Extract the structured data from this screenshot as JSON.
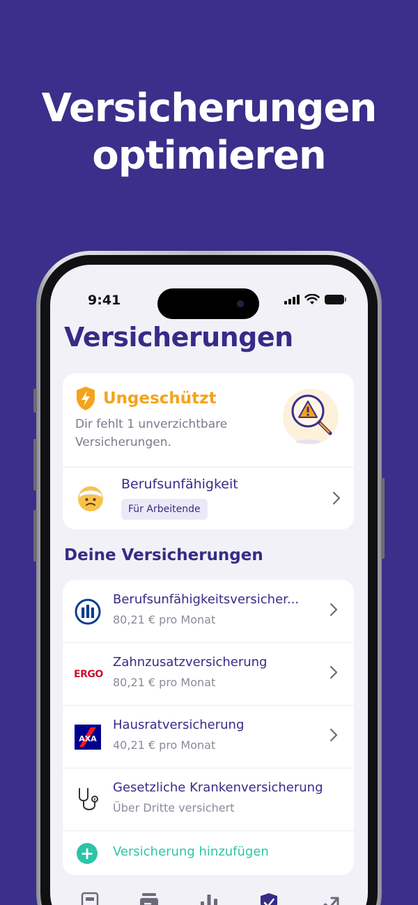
{
  "promo": {
    "headline_line1": "Versicherungen",
    "headline_line2": "optimieren"
  },
  "status_bar": {
    "time": "9:41"
  },
  "page": {
    "title": "Versicherungen"
  },
  "status_card": {
    "title": "Ungeschützt",
    "description": "Dir fehlt 1 unverzichtbare Versicherungen.",
    "missing_item": {
      "title": "Berufsunfähigkeit",
      "tag": "Für Arbeitende"
    }
  },
  "insurances": {
    "section_title": "Deine Versicherungen",
    "items": [
      {
        "title": "Berufsunfähigkeitsversicher...",
        "subtitle": "80,21 € pro Monat",
        "logo": "allianz-logo"
      },
      {
        "title": "Zahnzusatzversicherung",
        "subtitle": "80,21 € pro Monat",
        "logo": "ergo-logo",
        "logo_text": "ERGO"
      },
      {
        "title": "Hausratversicherung",
        "subtitle": "40,21 € pro Monat",
        "logo": "axa-logo",
        "logo_text": "AXA"
      },
      {
        "title": "Gesetzliche Krankenversicherung",
        "subtitle": "Über Dritte versichert",
        "logo": "stethoscope-icon"
      }
    ],
    "add_label": "Versicherung hinzufügen"
  },
  "colors": {
    "background": "#3a2f8a",
    "primary": "#352c86",
    "warning": "#f5a319",
    "accent": "#2cc4a6"
  },
  "tabbar": {
    "icons": [
      "document-icon",
      "wallet-icon",
      "bar-chart-icon",
      "shield-check-icon",
      "trend-up-icon"
    ],
    "active_index": 3
  }
}
